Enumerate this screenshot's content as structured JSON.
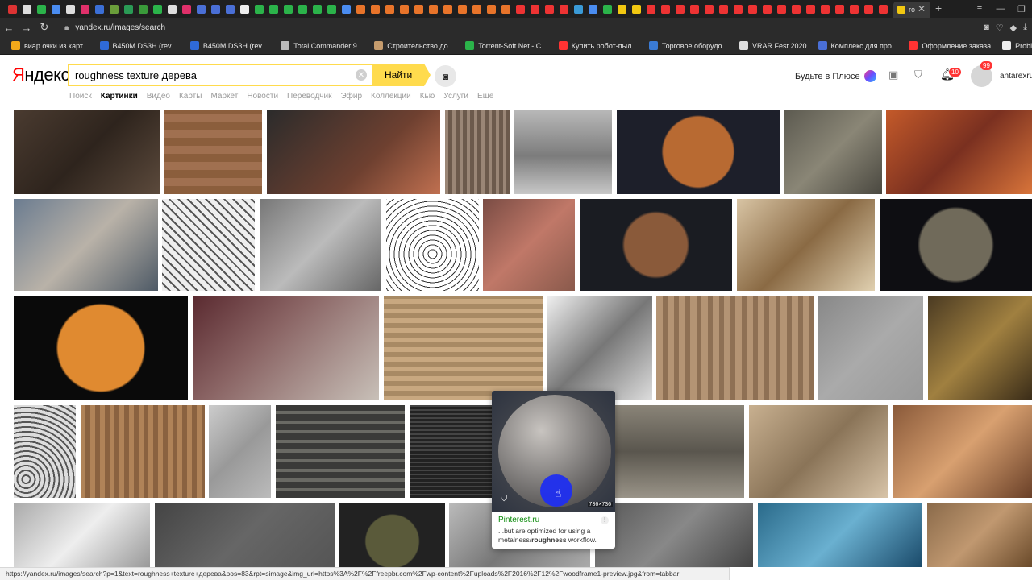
{
  "browser": {
    "active_tab_label": "ro",
    "tab_close": "✕",
    "new_tab": "+",
    "url": "yandex.ru/images/search",
    "tab_icon_colors": [
      "#d33",
      "#ddd",
      "#2bb34a",
      "#4a8cf0",
      "#ddd",
      "#e0306a",
      "#3b6fd6",
      "#6a9e3a",
      "#2a9a55",
      "#3a9a3a",
      "#2bb34a",
      "#ddd",
      "#e0306a",
      "#4a6fd6",
      "#4a6fd6",
      "#4a6fd6",
      "#eee",
      "#2bb34a",
      "#2bb34a",
      "#2bb34a",
      "#2bb34a",
      "#2bb34a",
      "#2bb34a",
      "#4a8cf0",
      "#e8742a",
      "#e8742a",
      "#e8742a",
      "#e8742a",
      "#e8742a",
      "#e8742a",
      "#e8742a",
      "#e8742a",
      "#e8742a",
      "#e8742a",
      "#e8742a",
      "#e33",
      "#e33",
      "#e33",
      "#e33",
      "#3a9ad6",
      "#4a8cf0",
      "#2bb34a",
      "#f2c811",
      "#f2c811",
      "#e33",
      "#e33",
      "#e33",
      "#e33",
      "#e33",
      "#e33",
      "#e33",
      "#e33",
      "#e33",
      "#e33",
      "#e33",
      "#e33",
      "#e33",
      "#e33",
      "#e33",
      "#e33",
      "#e33"
    ],
    "bookmarks": [
      {
        "label": "виар очки из карт...",
        "color": "#f2a81a"
      },
      {
        "label": "B450M DS3H (rev....",
        "color": "#2f6ad8"
      },
      {
        "label": "B450M DS3H (rev....",
        "color": "#2f6ad8"
      },
      {
        "label": "Total Commander 9...",
        "color": "#bbbbbb"
      },
      {
        "label": "Строительство до...",
        "color": "#c69c6d"
      },
      {
        "label": "Torrent-Soft.Net - C...",
        "color": "#2bb34a"
      },
      {
        "label": "Купить робот-пыл...",
        "color": "#ff3333"
      },
      {
        "label": "Торговое оборудо...",
        "color": "#3a7bd5"
      },
      {
        "label": "VRAR Fest 2020",
        "color": "#dddddd"
      },
      {
        "label": "Комплекс для про...",
        "color": "#4a6fd6"
      },
      {
        "label": "Оформление заказа",
        "color": "#ff3333"
      },
      {
        "label": "Problem Volume ph...",
        "color": "#eeeeee"
      }
    ]
  },
  "header": {
    "logo_first": "Я",
    "logo_rest": "ндекс",
    "search_value": "roughness texture дерева",
    "find_button": "Найти",
    "plus_label": "Будьте в Плюсе",
    "notif_count": "10",
    "avatar_count": "99",
    "username": "antarexru",
    "tabs": [
      {
        "label": "Поиск",
        "active": false
      },
      {
        "label": "Картинки",
        "active": true
      },
      {
        "label": "Видео",
        "active": false
      },
      {
        "label": "Карты",
        "active": false
      },
      {
        "label": "Маркет",
        "active": false
      },
      {
        "label": "Новости",
        "active": false
      },
      {
        "label": "Переводчик",
        "active": false
      },
      {
        "label": "Эфир",
        "active": false
      },
      {
        "label": "Коллекции",
        "active": false
      },
      {
        "label": "Кью",
        "active": false
      },
      {
        "label": "Услуги",
        "active": false
      },
      {
        "label": "Ещё",
        "active": false
      }
    ]
  },
  "popup": {
    "dimensions": "736×736",
    "source": "Pinterest.ru",
    "desc_prefix": "...but are optimized for using a metalness/",
    "desc_bold": "roughness",
    "desc_suffix": " workflow."
  },
  "status_url": "https://yandex.ru/images/search?p=1&text=roughness+texture+дерева&pos=83&rpt=simage&img_url=https%3A%2F%2Ffreepbr.com%2Fwp-content%2Fuploads%2F2016%2F12%2Fwoodframe1-preview.jpg&from=tabbar",
  "thumbnails": [
    {
      "style": "linear-gradient(135deg,#4a3b30,#2e241d 50%,#5c4a3c)"
    },
    {
      "style": "repeating-linear-gradient(0deg,#8b5e3c 0 10px,#a07050 10px 20px)"
    },
    {
      "style": "linear-gradient(135deg,#2b2b2b,#6e4030 60%,#c07050)"
    },
    {
      "style": "repeating-linear-gradient(90deg,#9a8676 0 4px,#6c5a4c 4px 9px)"
    },
    {
      "style": "linear-gradient(180deg,#b9b9b9,#7c7c7c 55%,#c8c8c8)"
    },
    {
      "style": "radial-gradient(circle at 50% 50%,#b86a32 0 38%,#1d1f2a 40%)"
    },
    {
      "style": "linear-gradient(135deg,#5c5a50,#8a8676 50%,#4a4840)"
    },
    {
      "style": "linear-gradient(135deg,#c45a2a,#7a3020 50%,#d8743a)"
    },
    {
      "style": "linear-gradient(135deg,#6b7c90,#b9b2a8 50%,#4e5a66)"
    },
    {
      "style": "repeating-linear-gradient(45deg,#eee 0 6px,#555 6px 8px)"
    },
    {
      "style": "linear-gradient(135deg,#777,#bbb 50%,#666)"
    },
    {
      "style": "repeating-radial-gradient(circle at 50% 60%,#fff 0 5px,#333 5px 6px)"
    },
    {
      "style": "linear-gradient(135deg,#7a4c44,#c07868 50%,#8a5a4c)"
    },
    {
      "style": "radial-gradient(circle at 50% 50%,#8a5a3a 0 35%,#1a1c22 38%)"
    },
    {
      "style": "linear-gradient(135deg,#d8c4a4,#8a6a44 50%,#e0d0b0)"
    },
    {
      "style": "radial-gradient(circle at 50% 50%,#706a5a 0 40%,#0e0e12 43%)"
    },
    {
      "style": "radial-gradient(circle at 50% 50%,#e08a30 0 42%,#0a0a0a 44%)"
    },
    {
      "style": "linear-gradient(135deg,#5a2a30,#8a6464 40%,#c8c0b8)"
    },
    {
      "style": "repeating-linear-gradient(0deg,#c8a880 0 6px,#a88a64 6px 12px)"
    },
    {
      "style": "linear-gradient(135deg,#f0f0f0,#777 50%,#ddd)"
    },
    {
      "style": "repeating-linear-gradient(90deg,#b49474 0 8px,#8e7054 8px 14px)"
    },
    {
      "style": "linear-gradient(135deg,#888,#aaa 50%,#999)"
    },
    {
      "style": "linear-gradient(135deg,#4a3a22,#a08040 50%,#3a2c18)"
    },
    {
      "style": "repeating-radial-gradient(circle at 20% 80%,#ddd 0 4px,#555 4px 6px)"
    },
    {
      "style": "repeating-linear-gradient(90deg,#b08358 0 6px,#8a6240 6px 12px)"
    },
    {
      "style": "linear-gradient(135deg,#ccc,#999 50%,#bbb)"
    },
    {
      "style": "repeating-linear-gradient(0deg,#3a3a38 0 8px,#6a6a64 8px 12px)"
    },
    {
      "style": "repeating-linear-gradient(0deg,#222 0 3px,#444 3px 5px)"
    },
    {
      "style": "linear-gradient(180deg,#8a8478,#5a564e 50%,#9a9488)"
    },
    {
      "style": "linear-gradient(135deg,#c8b090,#8a7458 50%,#d8c4a8)"
    },
    {
      "style": "linear-gradient(135deg,#8a5a3a,#d8a070 50%,#6a4028)"
    },
    {
      "style": "linear-gradient(135deg,#aaa,#eee 50%,#999)"
    },
    {
      "style": "linear-gradient(135deg,#444,#666 50%,#555)"
    },
    {
      "style": "radial-gradient(circle at 50% 60%,#5a5a3a 0 40%,#222 42%)"
    },
    {
      "style": "linear-gradient(135deg,#bbb,#777 50%,#aaa)"
    },
    {
      "style": "linear-gradient(135deg,#555,#888 50%,#444)"
    },
    {
      "style": "linear-gradient(135deg,#2a6a8a,#6ab0d0 50%,#1a4a6a)"
    },
    {
      "style": "linear-gradient(135deg,#8a6a4a,#c09870 50%,#6a4a2a)"
    }
  ]
}
